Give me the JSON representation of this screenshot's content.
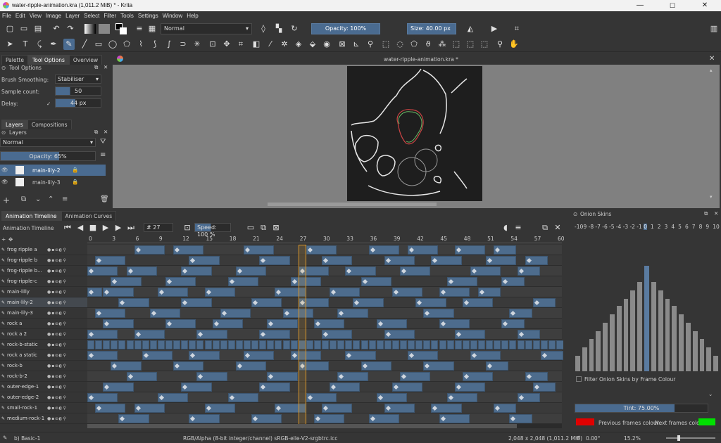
{
  "window": {
    "title": "water-ripple-animation.kra (1,011.2 MiB)  * - Krita",
    "min": "—",
    "max": "☐",
    "close": "✕"
  },
  "menu": [
    "File",
    "Edit",
    "View",
    "Image",
    "Layer",
    "Select",
    "Filter",
    "Tools",
    "Settings",
    "Window",
    "Help"
  ],
  "toolbar": {
    "blend_mode": "Normal",
    "opacity": "Opacity: 100%",
    "size": "Size: 40.00 px"
  },
  "left_dock": {
    "tabs": [
      "Palette",
      "Tool Options",
      "Overview"
    ],
    "tool_options_title": "Tool Options",
    "brush_smoothing_label": "Brush Smoothing:",
    "brush_smoothing_value": "Stabiliser",
    "sample_count_label": "Sample count:",
    "sample_count_value": "50",
    "delay_label": "Delay:",
    "delay_value": "44 px",
    "layers_tabs": [
      "Layers",
      "Compositions"
    ],
    "layers_title": "Layers",
    "layer_blend": "Normal",
    "layer_opacity": "Opacity:  65%",
    "layers": [
      "main-lily-2",
      "main-lily-3"
    ]
  },
  "canvas": {
    "doc_title": "water-ripple-animation.kra *"
  },
  "timeline": {
    "tabs": [
      "Animation Timeline",
      "Animation Curves"
    ],
    "title": "Animation Timeline",
    "frame": "# 27",
    "speed": "Speed: 100 %",
    "ruler": [
      "0",
      "3",
      "6",
      "9",
      "12",
      "15",
      "18",
      "21",
      "24",
      "27",
      "30",
      "33",
      "36",
      "39",
      "42",
      "45",
      "48",
      "51",
      "54",
      "57",
      "60"
    ],
    "current_frame": 27,
    "layers": [
      "frog ripple a",
      "frog-ripple b",
      "frog-ripple b...",
      "frog-ripple-c",
      "main-lilly",
      "main-lily-2",
      "main-lily-3",
      "rock a",
      "rock a 2",
      "rock-b-static",
      "rock a static",
      "rock-b",
      "rock-b-2",
      "outer-edge-1",
      "outer-edge-2",
      "small-rock-1",
      "medium-rock-1"
    ],
    "selected_layer": "main-lily-2"
  },
  "onion": {
    "title": "Onion Skins",
    "labels": [
      "-10",
      "-9",
      "-8",
      "-7",
      "-6",
      "-5",
      "-4",
      "-3",
      "-2",
      "-1",
      "0",
      "1",
      "2",
      "3",
      "4",
      "5",
      "6",
      "7",
      "8",
      "9",
      "10"
    ],
    "levels": [
      0.15,
      0.23,
      0.31,
      0.38,
      0.46,
      0.54,
      0.62,
      0.69,
      0.77,
      0.85,
      1,
      0.85,
      0.77,
      0.69,
      0.62,
      0.54,
      0.46,
      0.38,
      0.31,
      0.23,
      0.15
    ],
    "filter_label": "Filter Onion Skins by Frame Colour",
    "tint": "Tint: 75.00%",
    "prev_label": "Previous frames colour:",
    "next_label": "Next frames colour:",
    "prev_color": "#e00000",
    "next_color": "#00e000"
  },
  "status": {
    "brush": "b) Basic-1",
    "color_info": "RGB/Alpha (8-bit integer/channel)  sRGB-elle-V2-srgbtrc.icc",
    "size": "2,048 x 2,048 (1,011.2 MiB)",
    "rotation": "0.00°",
    "zoom": "15.2%"
  }
}
